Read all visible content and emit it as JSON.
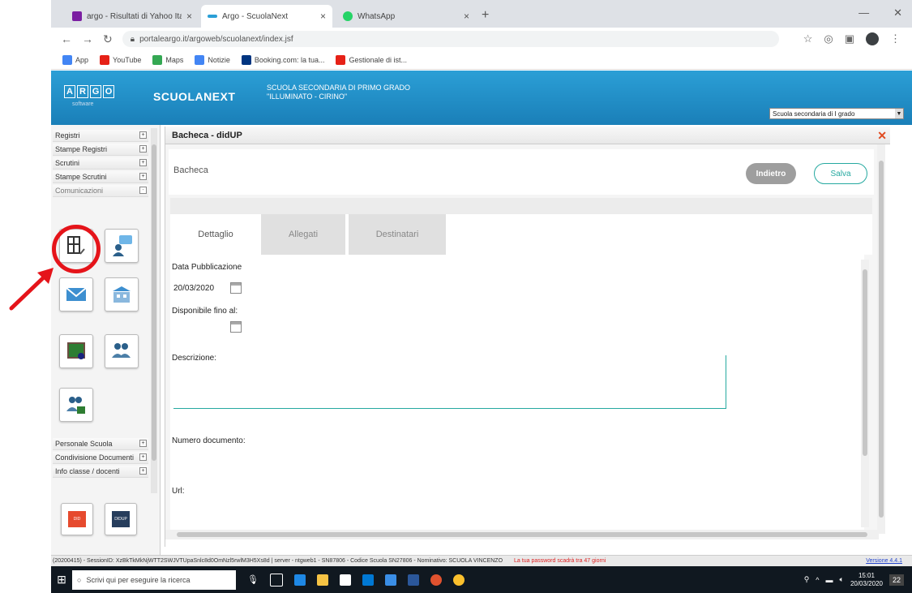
{
  "browser": {
    "tabs": [
      {
        "title": "argo - Risultati di Yahoo Italia Se...",
        "icon": "yahoo-icon",
        "color": "#7b1fa2"
      },
      {
        "title": "Argo - ScuolaNext",
        "icon": "argo-icon",
        "color": "#2b9fd6"
      },
      {
        "title": "WhatsApp",
        "icon": "whatsapp-icon",
        "color": "#25d366"
      }
    ],
    "new_tab": "+",
    "url": "portaleargo.it/argoweb/scuolanext/index.jsf",
    "bookmarks": [
      {
        "label": "App",
        "color": "#4285f4"
      },
      {
        "label": "YouTube",
        "color": "#e62117"
      },
      {
        "label": "Maps",
        "color": "#34a853"
      },
      {
        "label": "Notizie",
        "color": "#4285f4"
      },
      {
        "label": "Booking.com: la tua...",
        "color": "#003580"
      },
      {
        "label": "Gestionale di ist...",
        "color": "#e62117"
      }
    ]
  },
  "app": {
    "logo_letters": [
      "A",
      "R",
      "G",
      "O"
    ],
    "logo_sub": "software",
    "product": "SCUOLANEXT",
    "school_line1": "SCUOLA SECONDARIA DI PRIMO GRADO",
    "school_line2": "\"ILLUMINATO - CIRINO\"",
    "school_select": "Scuola secondaria di I grado",
    "brand_color": "#2b9fd6"
  },
  "sidebar": {
    "items_top": [
      {
        "label": "Registri",
        "sign": "+"
      },
      {
        "label": "Stampe Registri",
        "sign": "+"
      },
      {
        "label": "Scrutini",
        "sign": "+"
      },
      {
        "label": "Stampe Scrutini",
        "sign": "+"
      },
      {
        "label": "Comunicazioni",
        "sign": "-"
      }
    ],
    "items_bottom": [
      {
        "label": "Personale Scuola",
        "sign": "+"
      },
      {
        "label": "Condivisione Documenti",
        "sign": "+"
      },
      {
        "label": "Info classe / docenti",
        "sign": "+"
      }
    ],
    "quick_labels": [
      "DID",
      "DIDUP"
    ]
  },
  "panel": {
    "title": "Bacheca - didUP",
    "breadcrumb": "Bacheca",
    "back_label": "Indietro",
    "save_label": "Salva",
    "tabs": [
      "Dettaglio",
      "Allegati",
      "Destinatari"
    ],
    "fields": {
      "publish_label": "Data Pubblicazione",
      "publish_value": "20/03/2020",
      "until_label": "Disponibile fino al:",
      "description_label": "Descrizione:",
      "docnum_label": "Numero documento:",
      "url_label": "Url:"
    },
    "accent": "#26a9a0"
  },
  "status": {
    "text": "(20200415) - SessionID: XzBkTkMkNjWTT2SWJVTUpaSnlc8d0OmNzl5rwlM3H5Xs8d | server - ntgweb1 - SN87806 - Codice Scuola SN27806 - Nominativo: SCUOLA VINCENZO",
    "warning": "La tua password scadrà tra 47 giorni",
    "version": "Versione 4.4.1"
  },
  "taskbar": {
    "search_placeholder": "Scrivi qui per eseguire la ricerca",
    "time": "15:01",
    "date": "20/03/2020",
    "notifications": "22"
  }
}
